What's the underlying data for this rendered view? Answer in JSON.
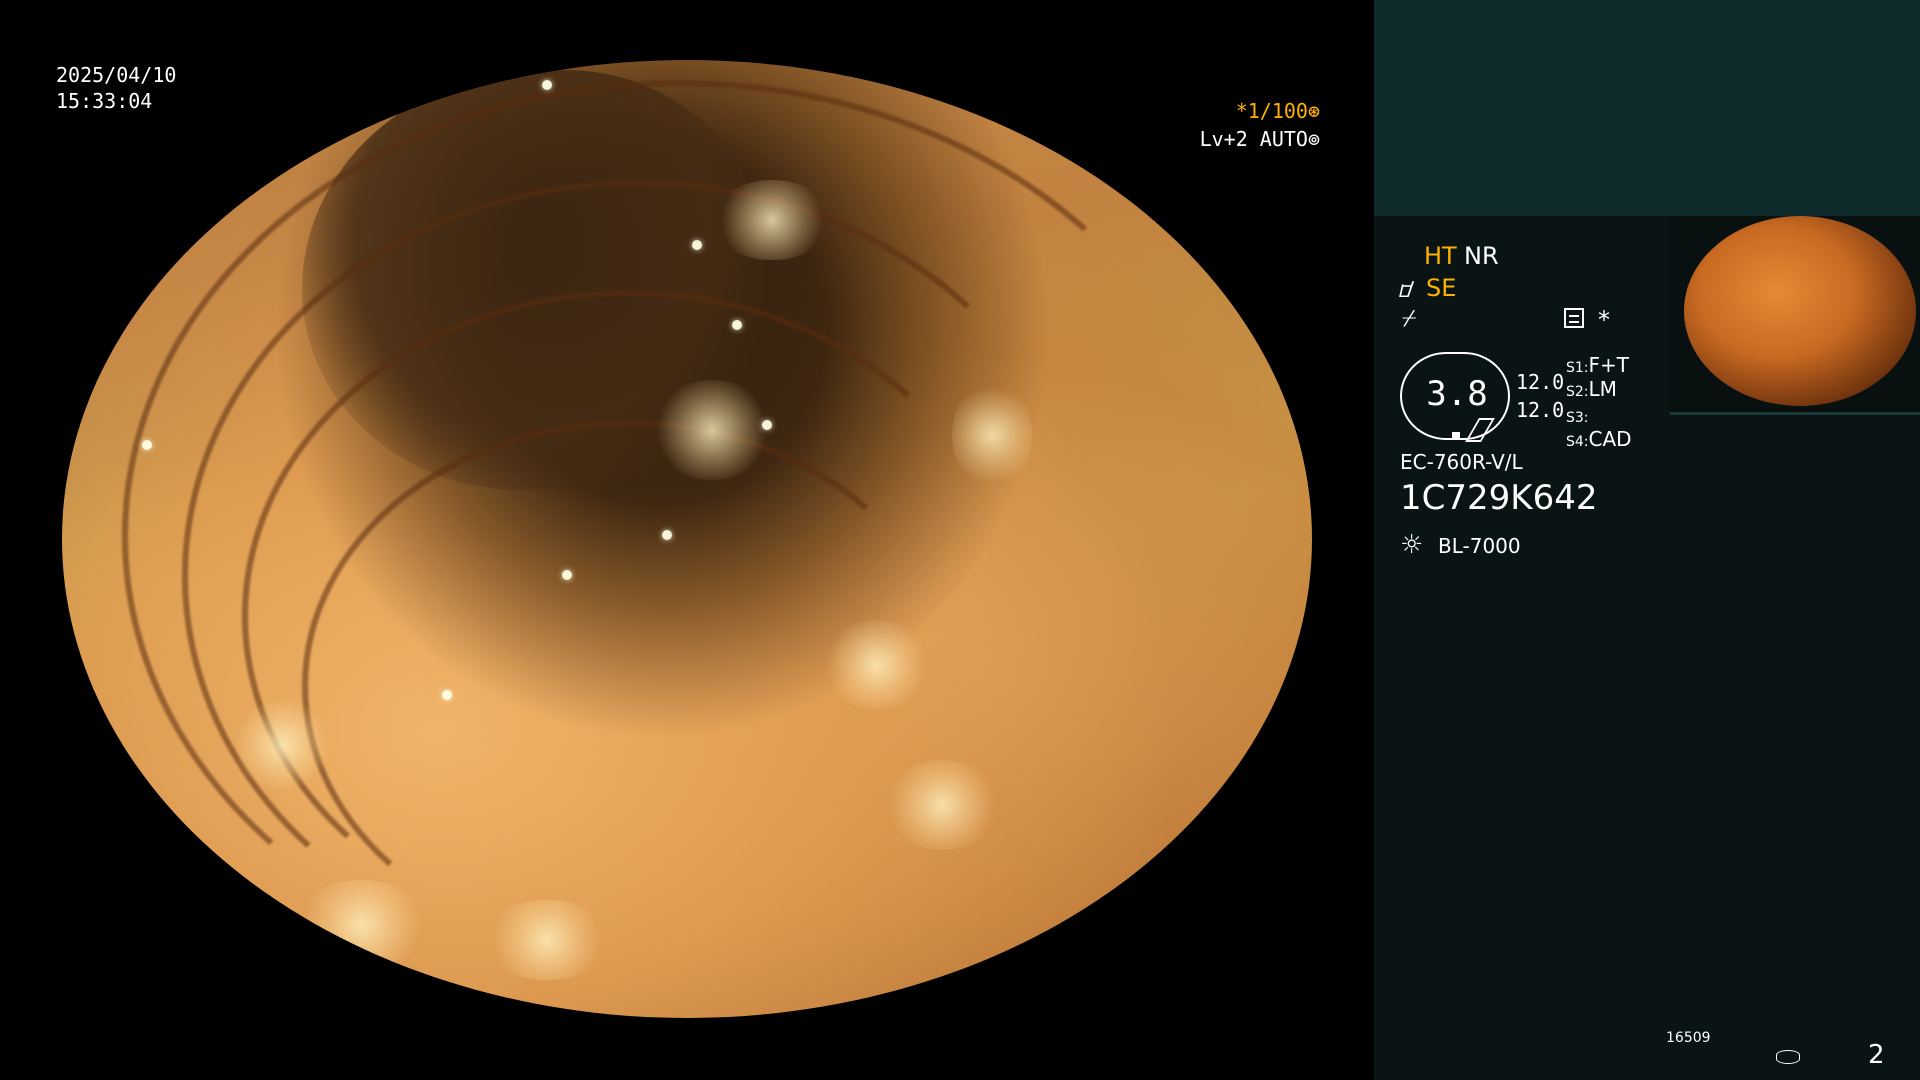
{
  "overlay": {
    "date": "2025/04/10",
    "time": "15:33:04",
    "shutter": "*1/100",
    "shutter_icon": "⊛",
    "level": "Lv+2 AUTO",
    "level_icon": "⊚"
  },
  "panel": {
    "ht": "HT",
    "nr": "NR",
    "se_icon": "ᝋ",
    "se": "SE",
    "f_icon": "⌿",
    "star": "*",
    "zoom": "3.8",
    "value1": "12.0",
    "value2": "12.0",
    "slots": [
      {
        "label": "S1:",
        "value": "F+T"
      },
      {
        "label": "S2:",
        "value": "LM"
      },
      {
        "label": "S3:",
        "value": ""
      },
      {
        "label": "S4:",
        "value": "CAD"
      }
    ],
    "scope_model": "EC-760R-V/L",
    "serial": "1C729K642",
    "light_icon": "☼",
    "light_source": "BL-7000",
    "counter": "16509",
    "page_number": "2"
  },
  "colors": {
    "accent": "#ffb000",
    "panel_bg": "#0a1414",
    "top_band": "#0f2b2b"
  }
}
